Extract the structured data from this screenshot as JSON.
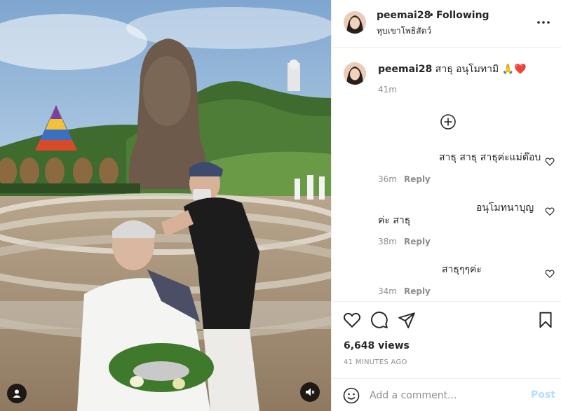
{
  "post": {
    "author": "peemai28",
    "separator": "•",
    "follow_status": "Following",
    "location": "หุบเขาโพธิสัตว์",
    "caption_author": "peemai28",
    "caption_text": "สาธุ อนุโมทามิ 🙏❤️",
    "caption_time": "41m"
  },
  "comments": [
    {
      "text": "สาธุ สาธุ สาธุค่ะแม่ต๊อบ",
      "time": "36m",
      "reply_label": "Reply"
    },
    {
      "text_line1": "อนุโมทนาบุญ",
      "text_line2": "ค่ะ สาธุ",
      "time": "38m",
      "reply_label": "Reply"
    },
    {
      "text": "สาธุๆๆค่ะ",
      "time": "34m",
      "reply_label": "Reply"
    }
  ],
  "stats": {
    "views": "6,648 views",
    "posted": "41 MINUTES AGO"
  },
  "composer": {
    "placeholder": "Add a comment...",
    "post_label": "Post"
  },
  "colors": {
    "link_disabled": "#b2dffc",
    "meta_gray": "#8e8e8e",
    "text": "#262626",
    "divider": "#efefef"
  },
  "icons": {
    "more": "ellipsis",
    "load_more": "plus-circle",
    "like": "heart",
    "comment": "speech-bubble",
    "share": "paper-plane",
    "save": "bookmark",
    "emoji": "smiley",
    "tagged_users": "user",
    "sound": "speaker-muted"
  }
}
